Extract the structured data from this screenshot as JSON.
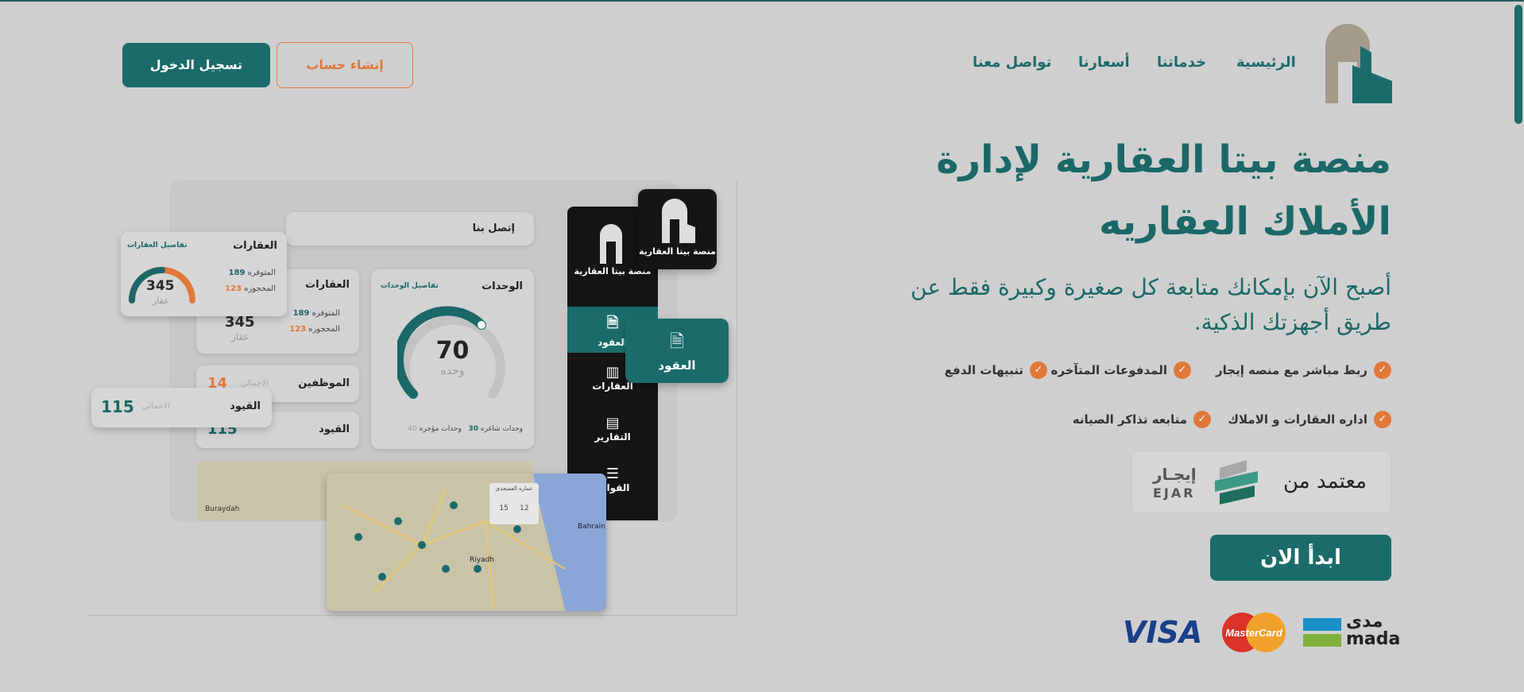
{
  "colors": {
    "primary": "#1c6b6b",
    "accent": "#e0783a",
    "background": "#cfcfcf"
  },
  "header": {
    "logo_icon": "building-logo-icon",
    "nav": [
      "الرئيسية",
      "خدماتنا",
      "أسعارنا",
      "تواصل معنا"
    ],
    "login_label": "تسجيل الدخول",
    "register_label": "إنشاء حساب"
  },
  "hero": {
    "title_line1": "منصة بيتا العقارية لإدارة",
    "title_line2": "الأملاك العقاريه",
    "subtitle_line1": "أصبح الآن بإمكانك متابعة كل صغيرة وكبيرة فقط عن",
    "subtitle_line2": "طريق أجهزتك الذكية.",
    "features": [
      "ربط مباشر مع منصه إيجار",
      "المدفوعات المتآخره",
      "تنبيهات الدفع",
      "اداره العقارات و الاملاك",
      "متابعه تذاكر الصيانه"
    ],
    "ejar": {
      "label": "معتمد من",
      "logo_ar": "إيجـار",
      "logo_en": "EJAR"
    },
    "start_label": "ابدأ الان",
    "payment_methods": [
      "VISA",
      "MasterCard",
      "مدى",
      "mada"
    ]
  },
  "mockup": {
    "brand": "منصة بيتا العقارية",
    "contact_tab": "إتصل بنا",
    "sidebar": [
      "العقود",
      "العقارات",
      "التقارير",
      "القوائم"
    ],
    "floating_tab": "العقود",
    "units": {
      "title": "الوحدات",
      "link": "تفاصيل الوحدات",
      "count": "70",
      "unit": "وحده",
      "vacant_label": "وحدات شاغره",
      "vacant": "30",
      "rented_label": "وحدات مؤجره",
      "rented": "40"
    },
    "properties": {
      "title": "العقارات",
      "link": "تفاصيل العقارات",
      "total": "345",
      "unit": "عقار",
      "available_label": "المتوفره",
      "available": "189",
      "booked_label": "المحجوزه",
      "booked": "123"
    },
    "employees": {
      "title": "الموظفين",
      "value": "14",
      "label": "الاجمالي"
    },
    "entries": {
      "title": "القيود",
      "value": "115",
      "label": "الاجمالي"
    },
    "map_labels": [
      "Bahrain",
      "Riyadh",
      "Buraydah"
    ],
    "map_popup": {
      "title": "عماره العسجدي",
      "a": "15",
      "b": "12"
    }
  }
}
